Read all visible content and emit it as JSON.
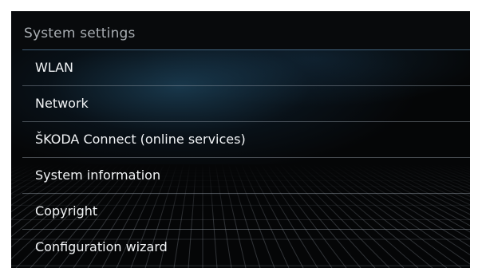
{
  "header": {
    "title": "System settings"
  },
  "menu": {
    "items": [
      {
        "label": "WLAN"
      },
      {
        "label": "Network"
      },
      {
        "label": "ŠKODA Connect (online services)"
      },
      {
        "label": "System information"
      },
      {
        "label": "Copyright"
      },
      {
        "label": "Configuration wizard"
      }
    ]
  },
  "colors": {
    "background": "#050607",
    "title_text": "#a9aeb3",
    "item_text": "#f2f4f6",
    "accent_glow": "#285f82"
  }
}
